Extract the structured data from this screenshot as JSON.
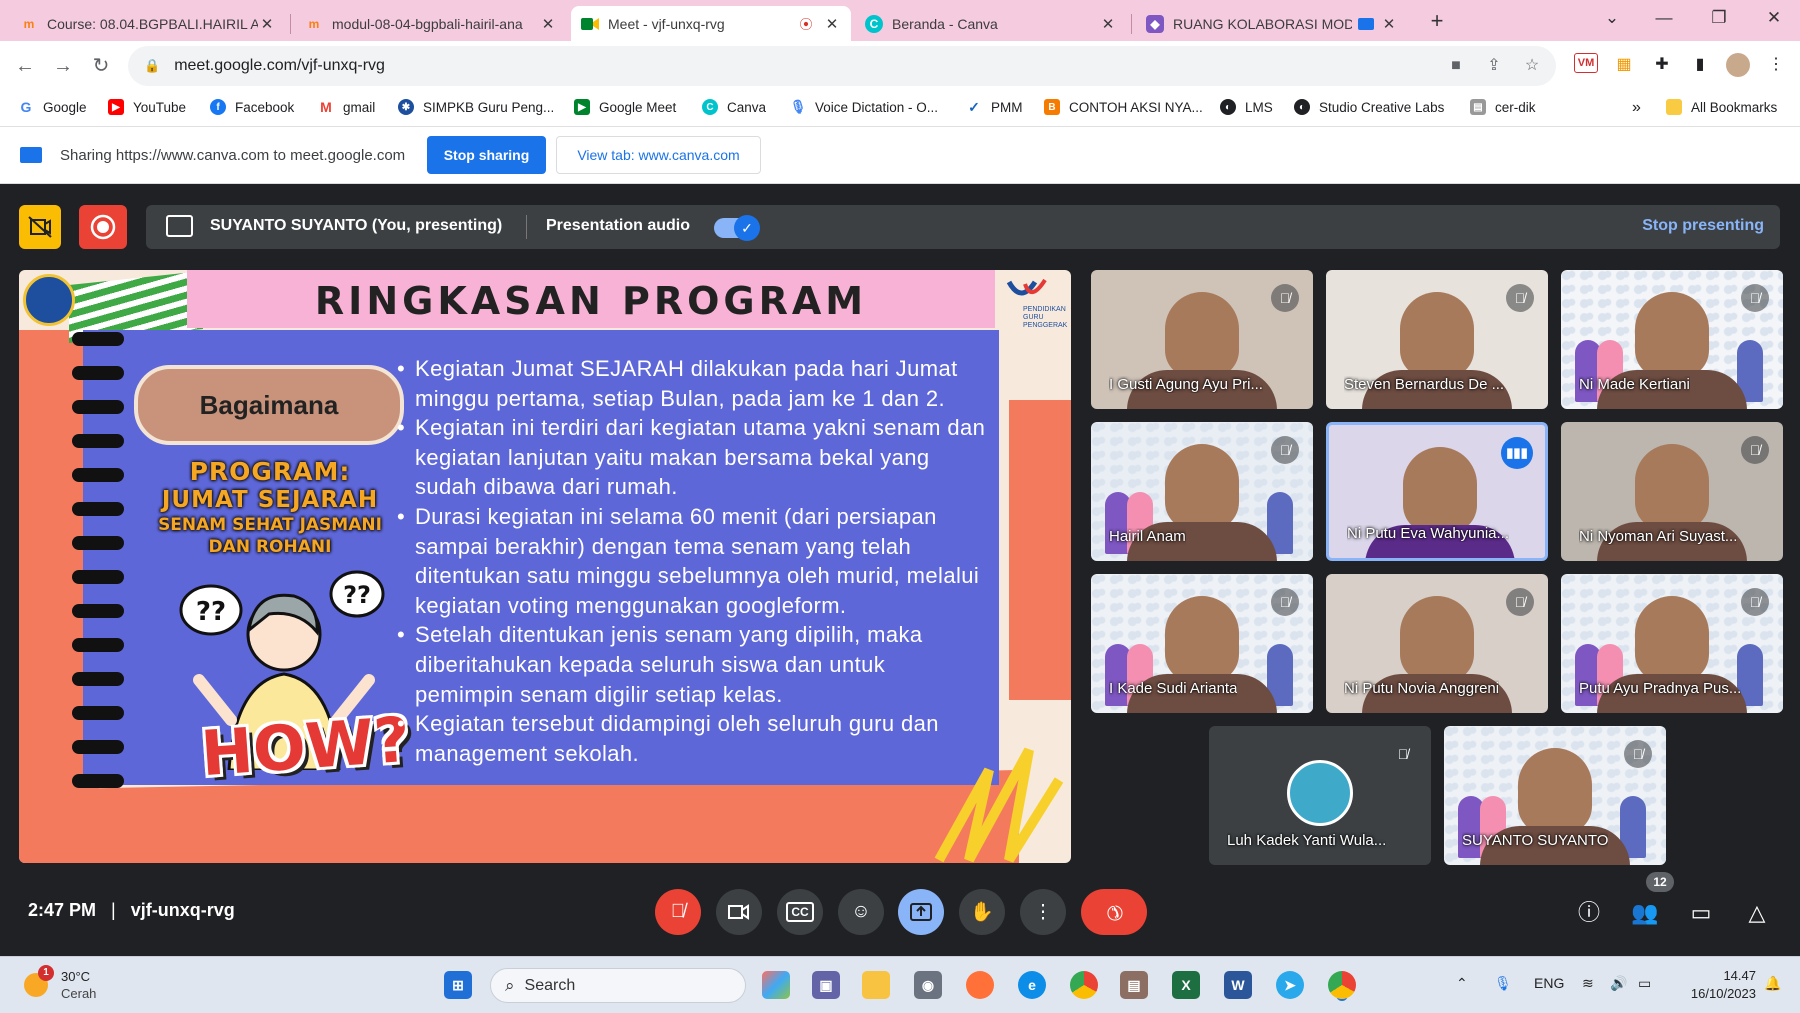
{
  "browser": {
    "tabs": [
      {
        "title": "Course: 08.04.BGPBALI.HAIRIL A",
        "icon": "moodle-icon",
        "active": false
      },
      {
        "title": "modul-08-04-bgpbali-hairil-ana",
        "icon": "moodle-icon",
        "active": false
      },
      {
        "title": "Meet - vjf-unxq-rvg",
        "icon": "meet-icon",
        "active": true,
        "recording": true
      },
      {
        "title": "Beranda - Canva",
        "icon": "canva-icon",
        "active": false
      },
      {
        "title": "RUANG KOLABORASI MOD",
        "icon": "google-sites-icon",
        "active": false
      }
    ],
    "url": "meet.google.com/vjf-unxq-rvg",
    "bookmarks": [
      {
        "label": "Google",
        "icon": "google-icon",
        "color": "#4285f4"
      },
      {
        "label": "YouTube",
        "icon": "youtube-icon",
        "color": "#ff0000"
      },
      {
        "label": "Facebook",
        "icon": "facebook-icon",
        "color": "#1877f2"
      },
      {
        "label": "gmail",
        "icon": "gmail-icon",
        "color": "#ea4335"
      },
      {
        "label": "SIMPKB Guru Peng...",
        "icon": "simpkb-icon",
        "color": "#1d4f9e"
      },
      {
        "label": "Google Meet",
        "icon": "meet-icon",
        "color": "#00832d"
      },
      {
        "label": "Canva",
        "icon": "canva-icon",
        "color": "#00c4cc"
      },
      {
        "label": "Voice Dictation - O...",
        "icon": "mic-icon",
        "color": "#4285f4"
      },
      {
        "label": "PMM",
        "icon": "pmm-icon",
        "color": "#1565c0"
      },
      {
        "label": "CONTOH AKSI NYA...",
        "icon": "blogger-icon",
        "color": "#f57c00"
      },
      {
        "label": "LMS",
        "icon": "globe-icon",
        "color": "#202124"
      },
      {
        "label": "Studio Creative Labs",
        "icon": "globe-icon",
        "color": "#202124"
      },
      {
        "label": "cer-dik",
        "icon": "page-icon",
        "color": "#777"
      }
    ],
    "all_bookmarks": "All Bookmarks"
  },
  "share_bar": {
    "text": "Sharing https://www.canva.com to meet.google.com",
    "stop_sharing": "Stop sharing",
    "view_tab": "View tab: www.canva.com"
  },
  "presenting_bar": {
    "presenter": "SUYANTO SUYANTO (You, presenting)",
    "audio_label": "Presentation audio",
    "audio_on": true,
    "stop": "Stop presenting"
  },
  "slide": {
    "title": "RINGKASAN PROGRAM",
    "tag": "Bagaimana",
    "program_1": "PROGRAM:",
    "program_2": "JUMAT SEJARAH",
    "program_3": "SENAM SEHAT JASMANI",
    "program_4": "DAN ROHANI",
    "how": "HOW?",
    "bubble": "??",
    "logo_text": "PENDIDIKAN GURU PENGGERAK",
    "bullets": [
      "Kegiatan Jumat SEJARAH dilakukan pada hari Jumat minggu pertama, setiap Bulan, pada jam ke 1 dan 2.",
      "Kegiatan ini terdiri dari kegiatan utama yakni senam dan kegiatan lanjutan yaitu makan bersama bekal yang sudah dibawa dari rumah.",
      "Durasi kegiatan ini selama 60 menit (dari persiapan sampai berakhir) dengan tema senam yang telah ditentukan satu minggu sebelumnya oleh murid, melalui kegiatan voting menggunakan googleform.",
      "Setelah ditentukan jenis senam yang dipilih, maka diberitahukan kepada seluruh siswa dan untuk pemimpin senam digilir setiap kelas.",
      "Kegiatan tersebut didampingi oleh seluruh guru dan management sekolah."
    ]
  },
  "participants": [
    {
      "name": "I Gusti Agung Ayu Pri...",
      "muted": true,
      "bg": "#cfc3b8"
    },
    {
      "name": "Steven Bernardus De ...",
      "muted": true,
      "bg": "#e7e2dc"
    },
    {
      "name": "Ni Made Kertiani",
      "muted": true,
      "bg": "#f3f5f8"
    },
    {
      "name": "Hairil Anam",
      "muted": true,
      "bg": "#e9eef4"
    },
    {
      "name": "Ni Putu Eva Wahyunia...",
      "muted": false,
      "bg": "#dcd6ea"
    },
    {
      "name": "Ni Nyoman Ari Suyast...",
      "muted": true,
      "bg": "#bdb6ae"
    },
    {
      "name": "I Kade Sudi Arianta",
      "muted": true,
      "bg": "#eef1f5"
    },
    {
      "name": "Ni Putu Novia Anggreni",
      "muted": true,
      "bg": "#d8cfc8"
    },
    {
      "name": "Putu Ayu Pradnya Pus...",
      "muted": true,
      "bg": "#eef1f5"
    },
    {
      "name": "Luh Kadek Yanti Wula...",
      "muted": true,
      "bg": "#3c4043"
    },
    {
      "name": "SUYANTO SUYANTO",
      "muted": true,
      "bg": "#eef1f5"
    }
  ],
  "meeting": {
    "time": "2:47 PM",
    "separator": "|",
    "code": "vjf-unxq-rvg",
    "participant_count": "12"
  },
  "taskbar": {
    "temp": "30°C",
    "weather": "Cerah",
    "alert": "1",
    "search": "Search",
    "lang": "ENG",
    "time": "14.47",
    "date": "16/10/2023"
  },
  "colors": {
    "accent": "#1a73e8",
    "slide_blue": "#5e67d8",
    "slide_pink": "#f8b2d5",
    "slide_orange": "#f47a5e",
    "meet_bg": "#202124",
    "end_call": "#ea4335"
  }
}
